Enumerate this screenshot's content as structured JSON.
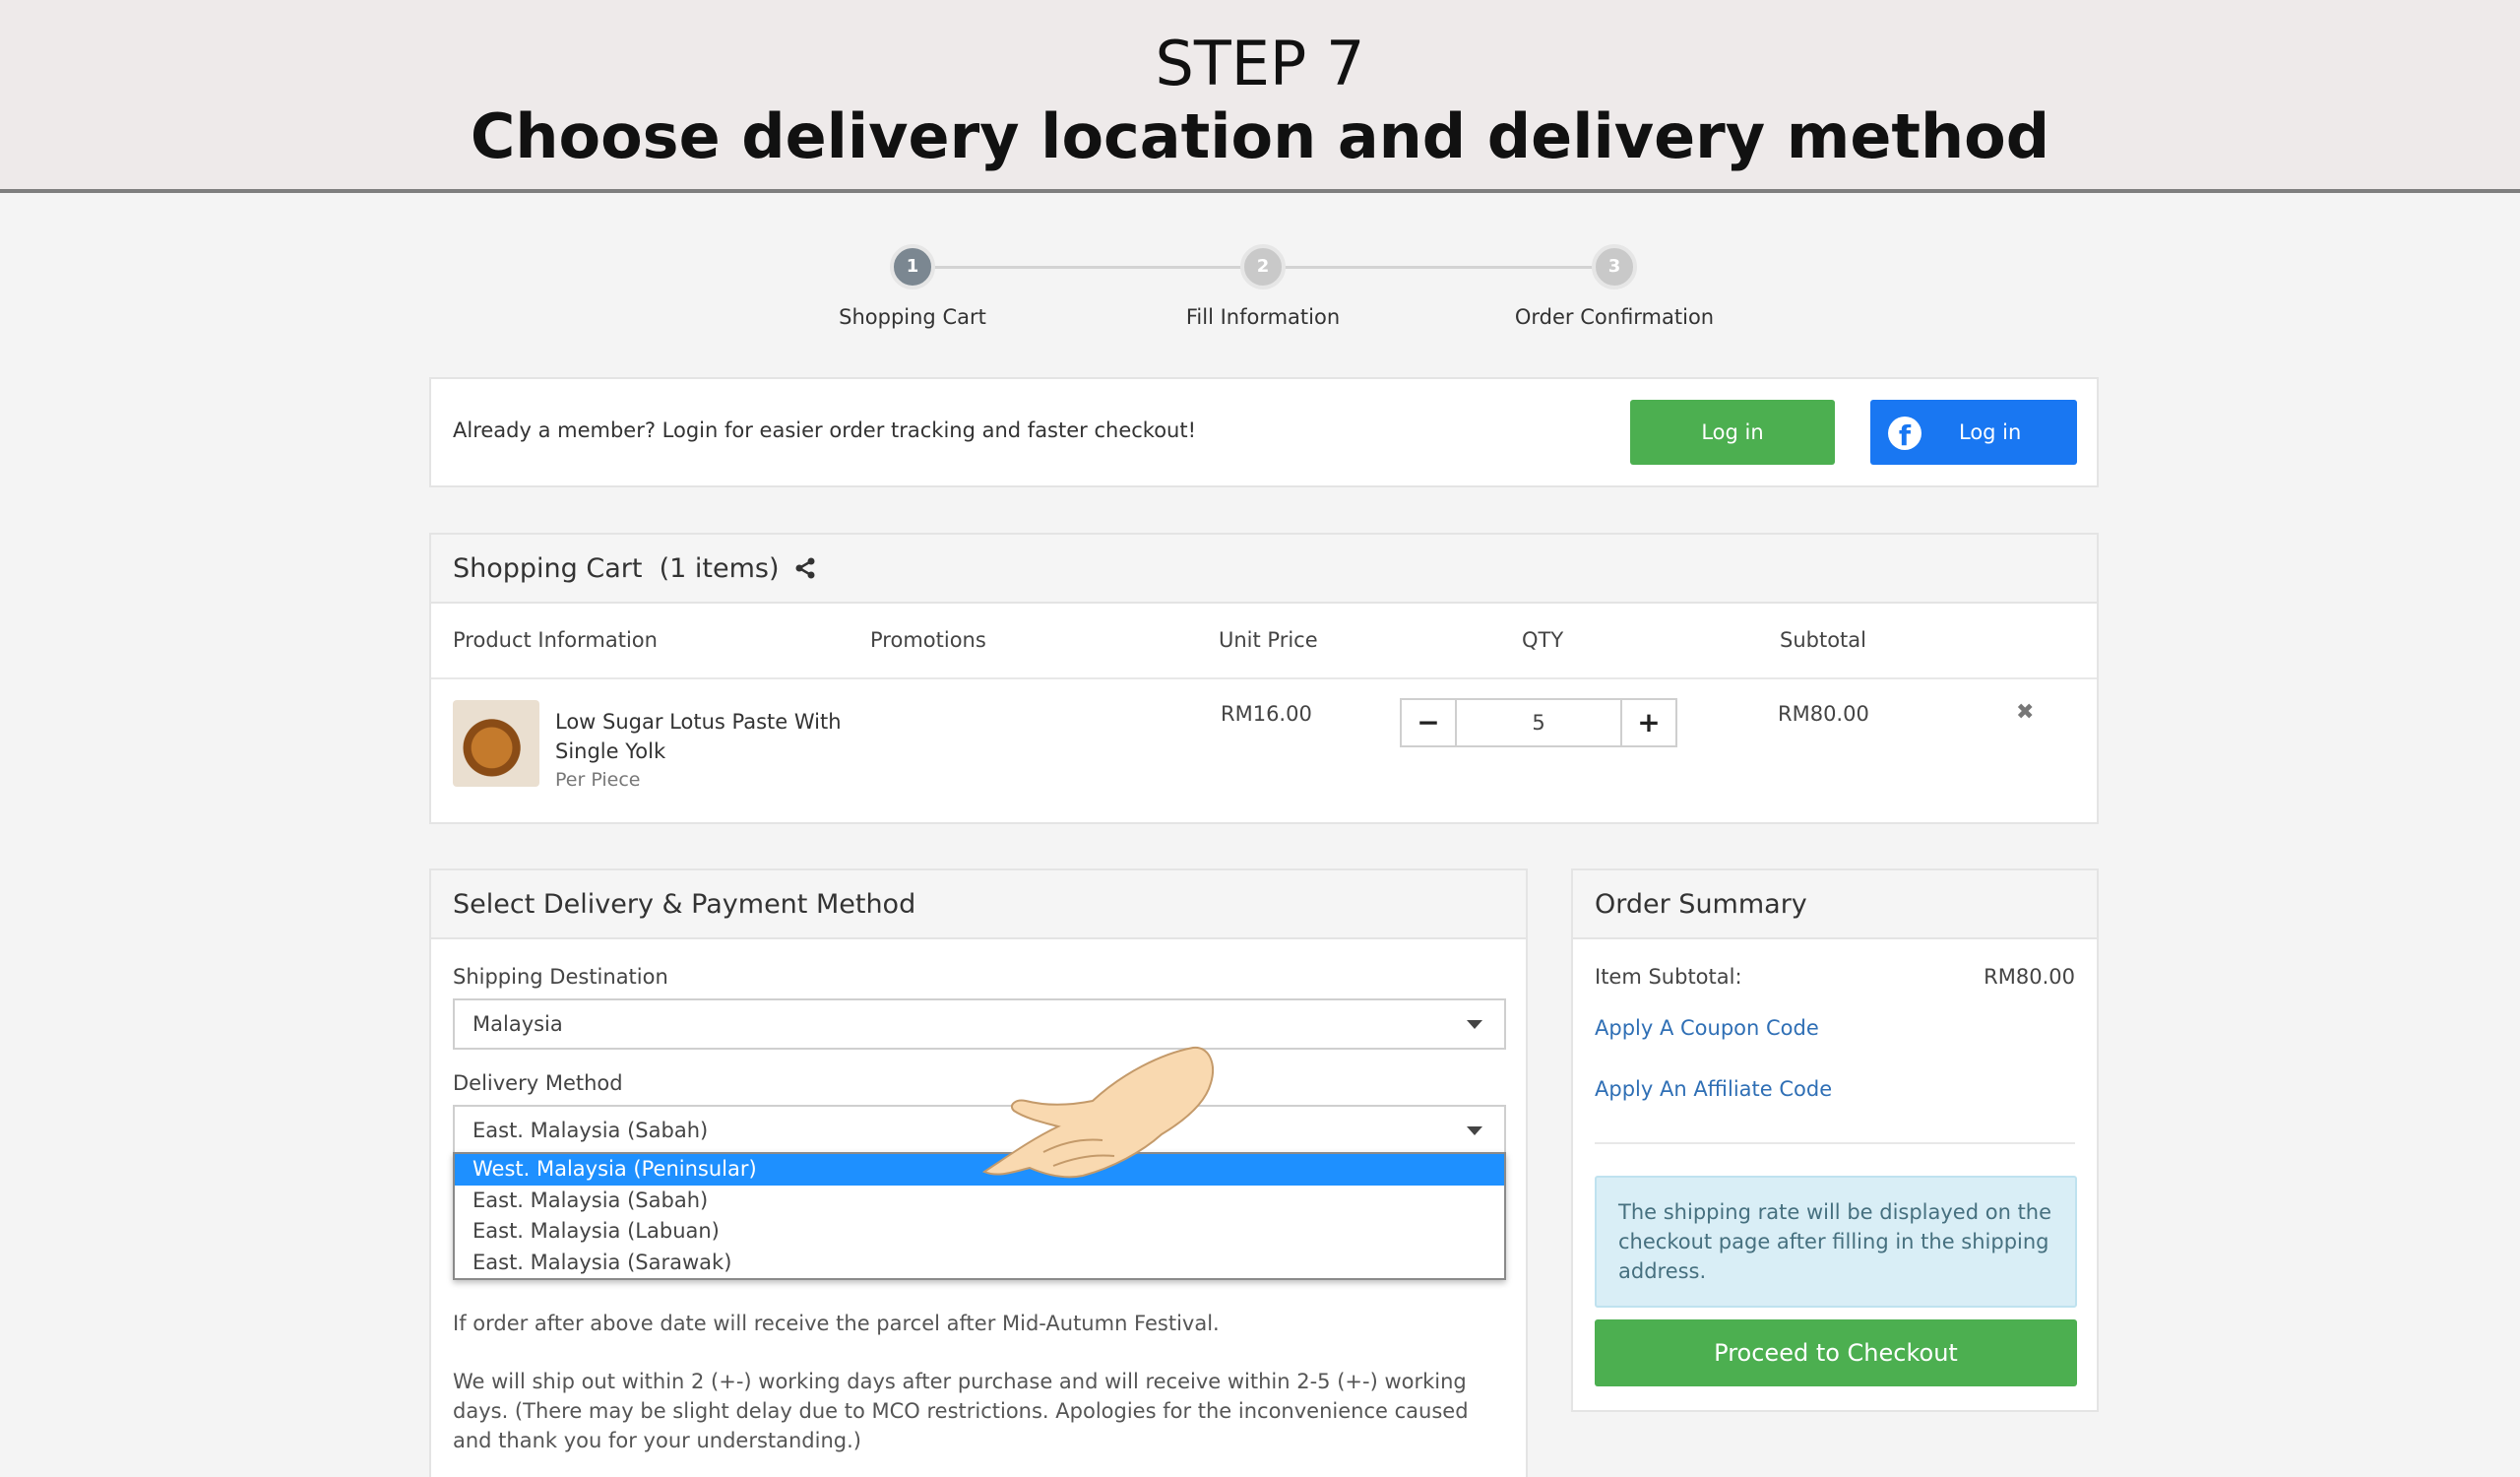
{
  "banner": {
    "step": "STEP 7",
    "headline": "Choose delivery location and delivery method"
  },
  "progress": {
    "steps": [
      {
        "num": "1",
        "label": "Shopping Cart"
      },
      {
        "num": "2",
        "label": "Fill Information"
      },
      {
        "num": "3",
        "label": "Order Confirmation"
      }
    ]
  },
  "login": {
    "message": "Already a member? Login for easier order tracking and faster checkout!",
    "login_label": "Log in",
    "fb_login_label": "Log in"
  },
  "cart": {
    "title": "Shopping Cart",
    "count": "(1 items)",
    "headers": {
      "product": "Product Information",
      "promotions": "Promotions",
      "unit_price": "Unit Price",
      "qty": "QTY",
      "subtotal": "Subtotal"
    },
    "item": {
      "name_line1": "Low Sugar Lotus Paste With",
      "name_line2": "Single Yolk",
      "unit": "Per Piece",
      "unit_price": "RM16.00",
      "qty": "5",
      "subtotal": "RM80.00",
      "minus": "−",
      "plus": "+",
      "remove": "✖"
    }
  },
  "delivery": {
    "title": "Select Delivery & Payment Method",
    "shipping_label": "Shipping Destination",
    "shipping_value": "Malaysia",
    "method_label": "Delivery Method",
    "method_value": "East. Malaysia (Sabah)",
    "options": [
      "West. Malaysia (Peninsular)",
      "East. Malaysia (Sabah)",
      "East. Malaysia (Labuan)",
      "East. Malaysia (Sarawak)"
    ],
    "note1": "If order after above date will receive the parcel after Mid-Autumn Festival.",
    "note2": "We will ship out within 2 (+-) working days after purchase and will receive within 2-5 (+-) working days. (There may be slight delay due to MCO restrictions. Apologies for the inconvenience caused and thank you for your understanding.)"
  },
  "summary": {
    "title": "Order Summary",
    "subtotal_label": "Item Subtotal:",
    "subtotal_value": "RM80.00",
    "coupon_link": "Apply A Coupon Code",
    "affiliate_link": "Apply An Affiliate Code",
    "shipping_note": "The shipping rate will be displayed on the checkout page after filling in the shipping address.",
    "checkout_label": "Proceed to Checkout"
  },
  "colors": {
    "green": "#4caf50",
    "facebook_blue": "#1977f2",
    "selected_option": "#1e90ff",
    "link": "#2f6fb5"
  },
  "icons": {
    "share": "share-icon",
    "facebook": "facebook-icon",
    "remove": "close-icon",
    "caret": "chevron-down-icon",
    "hand": "pointing-hand-icon"
  }
}
